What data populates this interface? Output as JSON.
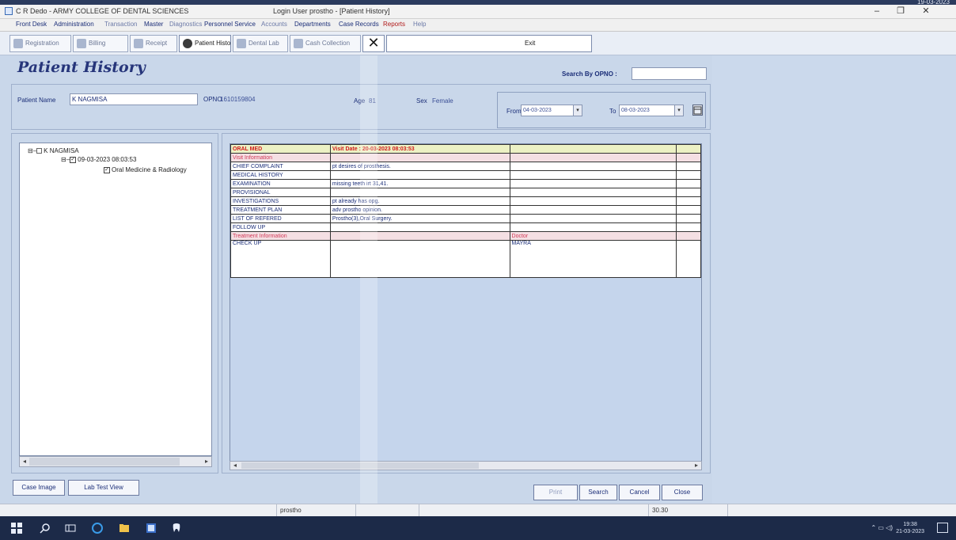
{
  "window": {
    "title": "C R Dedo - ARMY COLLEGE OF DENTAL SCIENCES",
    "subtitle": "Login User prostho - [Patient History]",
    "clock": "19-03-2023"
  },
  "menu": {
    "items": [
      {
        "label": "Front Desk",
        "style": "normal"
      },
      {
        "label": "Administration",
        "style": "normal"
      },
      {
        "label": "Transaction",
        "style": "dim"
      },
      {
        "label": "Master",
        "style": "normal"
      },
      {
        "label": "Diagnostics",
        "style": "dim"
      },
      {
        "label": "Personnel Service",
        "style": "normal"
      },
      {
        "label": "Accounts",
        "style": "dim"
      },
      {
        "label": "Departments",
        "style": "normal"
      },
      {
        "label": "Case Records",
        "style": "normal"
      },
      {
        "label": "Reports",
        "style": "red"
      },
      {
        "label": "Help",
        "style": "dim"
      }
    ]
  },
  "toolbar": {
    "registration": "Registration",
    "billing": "Billing",
    "receipt": "Receipt",
    "patient_history": "Patient History",
    "dental_lab": "Dental Lab",
    "cash_details": "Cash Collection",
    "exit": "Exit"
  },
  "page": {
    "title": "Patient History",
    "search_label": "Search By OPNO :",
    "search_value": ""
  },
  "patient": {
    "name_label": "Patient Name",
    "name_value": "K NAGMISA",
    "opno_label": "OPNO",
    "opno_value": "1610159804",
    "age_label": "Age",
    "age_value": "81",
    "sex_label": "Sex",
    "sex_value": "Female"
  },
  "date_range": {
    "from_label": "From",
    "from_value": "04-03-2023",
    "to_label": "To",
    "to_value": "08-03-2023"
  },
  "tree": {
    "root": "K NAGMISA",
    "visit": "09-03-2023 08:03:53",
    "dept": "Oral Medicine & Radiology"
  },
  "grid": {
    "rows": [
      {
        "type": "hdr",
        "c1": "ORAL MED",
        "c2": "Visit Date : 20-03-2023 08:03:53",
        "c3": "",
        "c4": ""
      },
      {
        "type": "pink",
        "c1": "Visit Information",
        "c2": "",
        "c3": "",
        "c4": ""
      },
      {
        "type": "normal",
        "c1": "CHIEF COMPLAINT",
        "c2": "pt desires of prosthesis.",
        "c3": "",
        "c4": ""
      },
      {
        "type": "normal",
        "c1": "MEDICAL HISTORY",
        "c2": "",
        "c3": "",
        "c4": ""
      },
      {
        "type": "normal",
        "c1": "EXAMINATION",
        "c2": "missing teeth irt 31,41.",
        "c3": "",
        "c4": ""
      },
      {
        "type": "normal",
        "c1": "PROVISIONAL",
        "c2": "",
        "c3": "",
        "c4": ""
      },
      {
        "type": "normal",
        "c1": "INVESTIGATIONS",
        "c2": "pt already has opg.",
        "c3": "",
        "c4": ""
      },
      {
        "type": "normal",
        "c1": "TREATMENT PLAN",
        "c2": "adv prostho opinion.",
        "c3": "",
        "c4": ""
      },
      {
        "type": "normal",
        "c1": "LIST OF REFERED",
        "c2": "Prostho(3),Oral Surgery.",
        "c3": "",
        "c4": ""
      },
      {
        "type": "normal",
        "c1": "FOLLOW UP",
        "c2": "",
        "c3": "",
        "c4": ""
      },
      {
        "type": "pink",
        "c1": "Treatment Information",
        "c2": "",
        "c3": "Doctor",
        "c4": ""
      },
      {
        "type": "tall",
        "c1": "CHECK UP",
        "c2": "",
        "c3": "MAYRA",
        "c4": ""
      }
    ]
  },
  "bottom": {
    "case_image": "Case Image",
    "lab_test_view": "Lab Test View",
    "print": "Print",
    "search": "Search",
    "cancel": "Cancel",
    "close": "Close"
  },
  "status": {
    "user": "prostho",
    "num": "30.30"
  },
  "taskbar": {
    "time": "19:38",
    "date": "21-03-2023"
  }
}
